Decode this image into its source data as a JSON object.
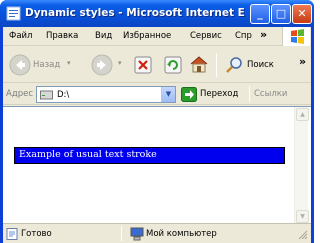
{
  "window": {
    "title": "Dynamic styles - Microsoft Internet E",
    "buttons": {
      "minimize": "_",
      "maximize": "□",
      "close": "✕"
    }
  },
  "menu": {
    "items": [
      "Файл",
      "Правка",
      "Вид",
      "Избранное",
      "Сервис",
      "Спр"
    ],
    "more": "»"
  },
  "toolbar": {
    "back_label": "Назад",
    "search_label": "Поиск",
    "more": "»",
    "icons": [
      "back-arrow-icon",
      "forward-arrow-icon",
      "stop-icon",
      "refresh-icon",
      "home-icon",
      "search-icon"
    ]
  },
  "address": {
    "label": "Адрес",
    "value": "D:\\",
    "go_label": "Переход",
    "links_label": "Ссылки"
  },
  "content": {
    "demo_text": "Example of usual text stroke",
    "demo_background": "#0000ee",
    "demo_color": "#ffffff"
  },
  "status": {
    "text": "Готово",
    "zone": "Мой компьютер"
  },
  "colors": {
    "titlebar": "#0a50d8",
    "chrome": "#ece9d8",
    "accent_go": "#2a9d2a"
  }
}
